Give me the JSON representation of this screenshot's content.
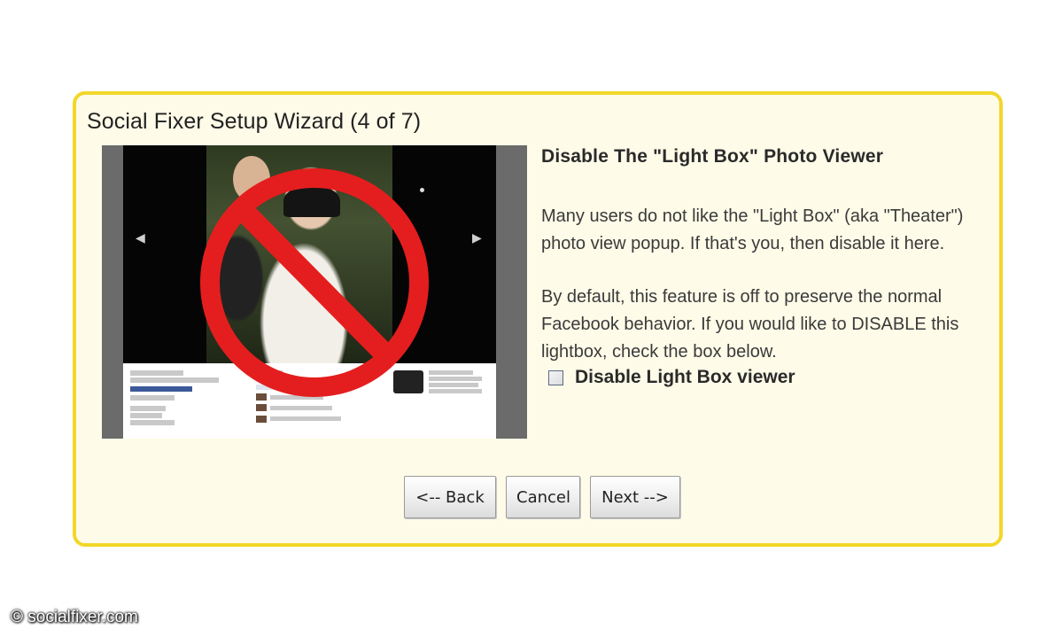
{
  "wizard": {
    "title": "Social Fixer Setup Wizard (4 of 7)",
    "heading": "Disable The \"Light Box\" Photo Viewer",
    "paragraph_1": "Many users do not like the \"Light Box\" (aka \"Theater\") photo view popup. If that's you, then disable it here.",
    "paragraph_2": "By default, this feature is off to preserve the normal Facebook behavior. If you would like to DISABLE this lightbox, check the box below.",
    "checkbox_label": "Disable Light Box viewer",
    "checkbox_checked": false
  },
  "buttons": {
    "back_label": "<-- Back",
    "cancel_label": "Cancel",
    "next_label": "Next -->"
  },
  "colors": {
    "frame_border": "#f2d72a",
    "frame_background": "#fefbe8",
    "prohibition_sign": "#e41e1e"
  },
  "credit": "© socialfixer.com"
}
